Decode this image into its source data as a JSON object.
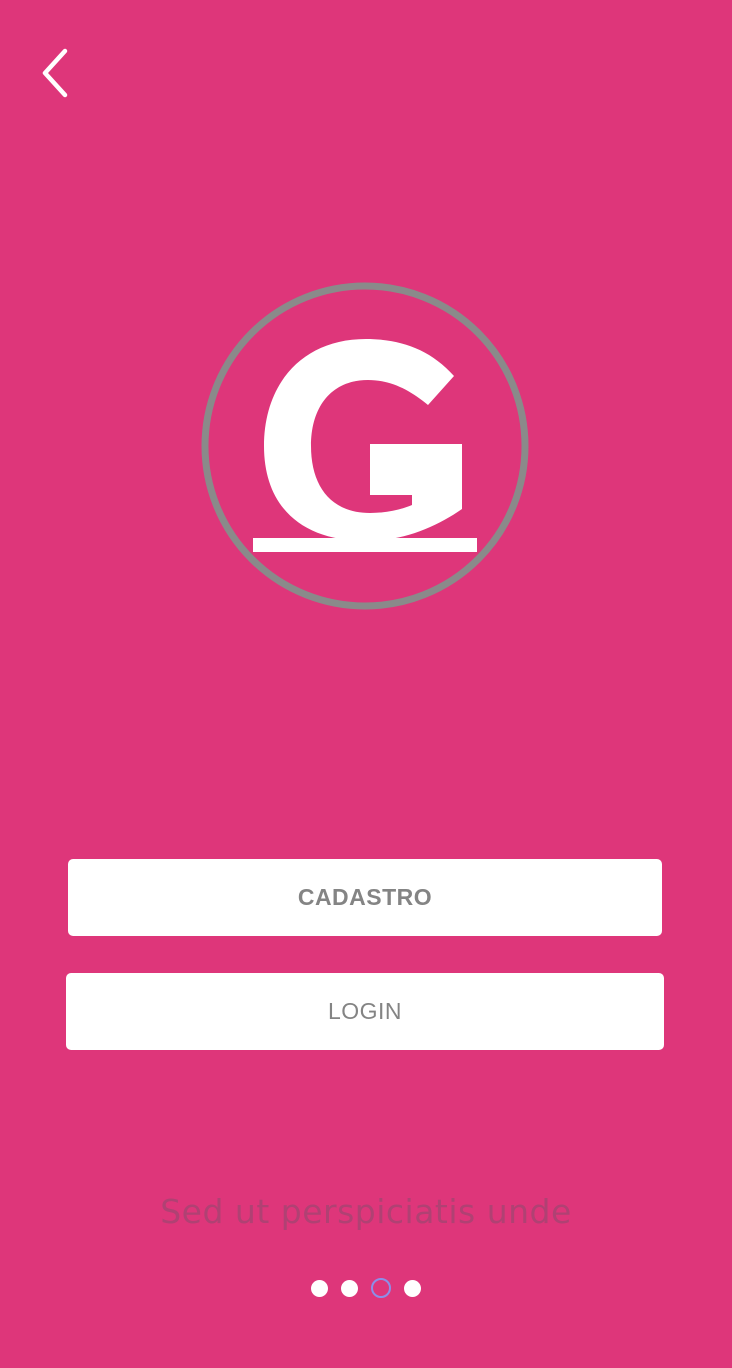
{
  "theme": {
    "background": "#DE367A",
    "button_background": "#FFFFFF",
    "button_text": "#848484",
    "logo_ring": "#8A8A8A",
    "logo_letter": "#FFFFFF",
    "tagline_color": "#A84472",
    "active_dot_outline": "#8C8FE8"
  },
  "header": {
    "back_icon": "chevron-left-icon"
  },
  "logo": {
    "icon": "g-logo-icon"
  },
  "actions": {
    "signup_label": "CADASTRO",
    "login_label": "LOGIN"
  },
  "tagline": "Sed ut perspiciatis unde",
  "pager": {
    "total": 4,
    "active_index": 2
  }
}
